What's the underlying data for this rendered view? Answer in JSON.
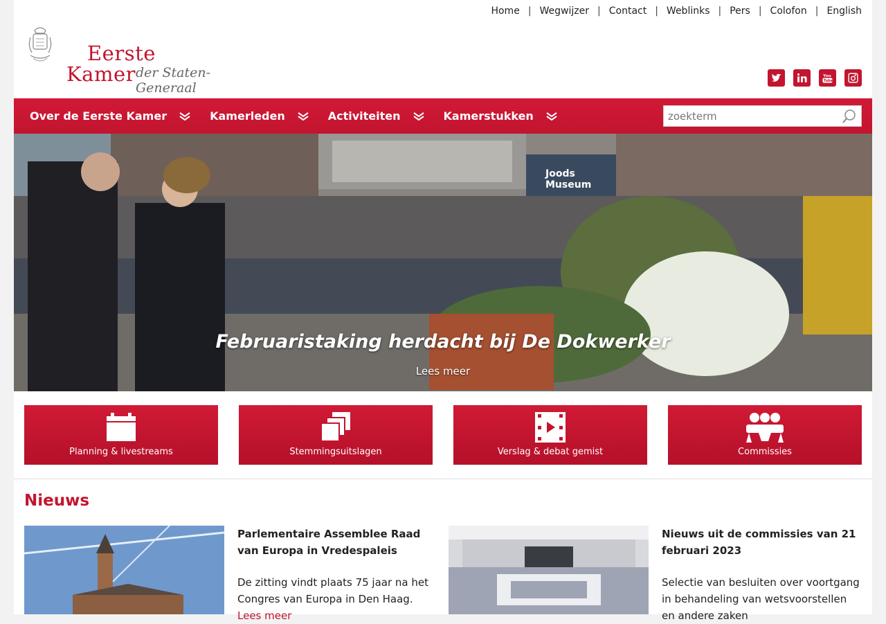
{
  "top_links": [
    "Home",
    "Wegwijzer",
    "Contact",
    "Weblinks",
    "Pers",
    "Colofon",
    "English"
  ],
  "logo": {
    "line1": "Eerste",
    "line2": "Kamer",
    "line3": "der Staten-Generaal"
  },
  "social": [
    "twitter-icon",
    "linkedin-icon",
    "youtube-icon",
    "instagram-icon"
  ],
  "brand_color": "#c2152f",
  "nav": [
    "Over de Eerste Kamer",
    "Kamerleden",
    "Activiteiten",
    "Kamerstukken"
  ],
  "search": {
    "placeholder": "zoekterm"
  },
  "hero": {
    "title": "Februaristaking herdacht bij De Dokwerker",
    "more": "Lees meer"
  },
  "tiles": [
    {
      "label": "Planning & livestreams",
      "icon": "calendar-icon"
    },
    {
      "label": "Stemmingsuitslagen",
      "icon": "stacked-cards-icon"
    },
    {
      "label": "Verslag & debat gemist",
      "icon": "film-icon"
    },
    {
      "label": "Commissies",
      "icon": "group-icon"
    }
  ],
  "news_heading": "Nieuws",
  "news": [
    {
      "title": "Parlementaire Assemblee Raad van Europa in Vredespaleis",
      "text": "De zitting vindt plaats 75 jaar na het Congres van Europa in Den Haag.",
      "more": "Lees meer"
    },
    {
      "title": "Nieuws uit de commissies van 21 februari 2023",
      "text": "Selectie van besluiten over voortgang in behandeling van wetsvoorstellen en andere zaken",
      "more": ""
    }
  ]
}
